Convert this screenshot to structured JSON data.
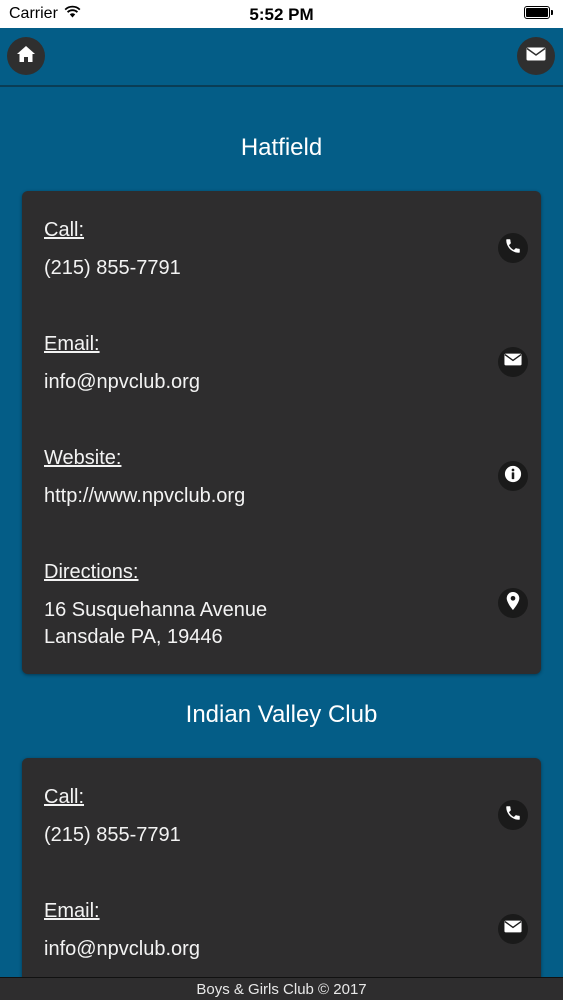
{
  "status_bar": {
    "carrier": "Carrier",
    "time": "5:52 PM"
  },
  "icons": {
    "home": "home-icon",
    "mail": "mail-icon",
    "phone": "phone-icon",
    "info": "info-icon",
    "location": "location-pin-icon",
    "wifi": "wifi-icon",
    "battery": "battery-icon"
  },
  "colors": {
    "background": "#045d87",
    "card": "#2e2d2e",
    "icon_circle": "#1a1a1a"
  },
  "locations": [
    {
      "name": "Hatfield",
      "call_label": "Call:",
      "phone": "(215) 855-7791",
      "email_label": "Email:",
      "email": "info@npvclub.org",
      "website_label": "Website:",
      "website": "http://www.npvclub.org",
      "directions_label": "Directions:",
      "address_line1": "16 Susquehanna Avenue",
      "address_line2": "Lansdale PA, 19446"
    },
    {
      "name": "Indian Valley Club",
      "call_label": "Call:",
      "phone": "(215) 855-7791",
      "email_label": "Email:",
      "email": "info@npvclub.org"
    }
  ],
  "footer": {
    "text": "Boys & Girls Club © 2017"
  }
}
